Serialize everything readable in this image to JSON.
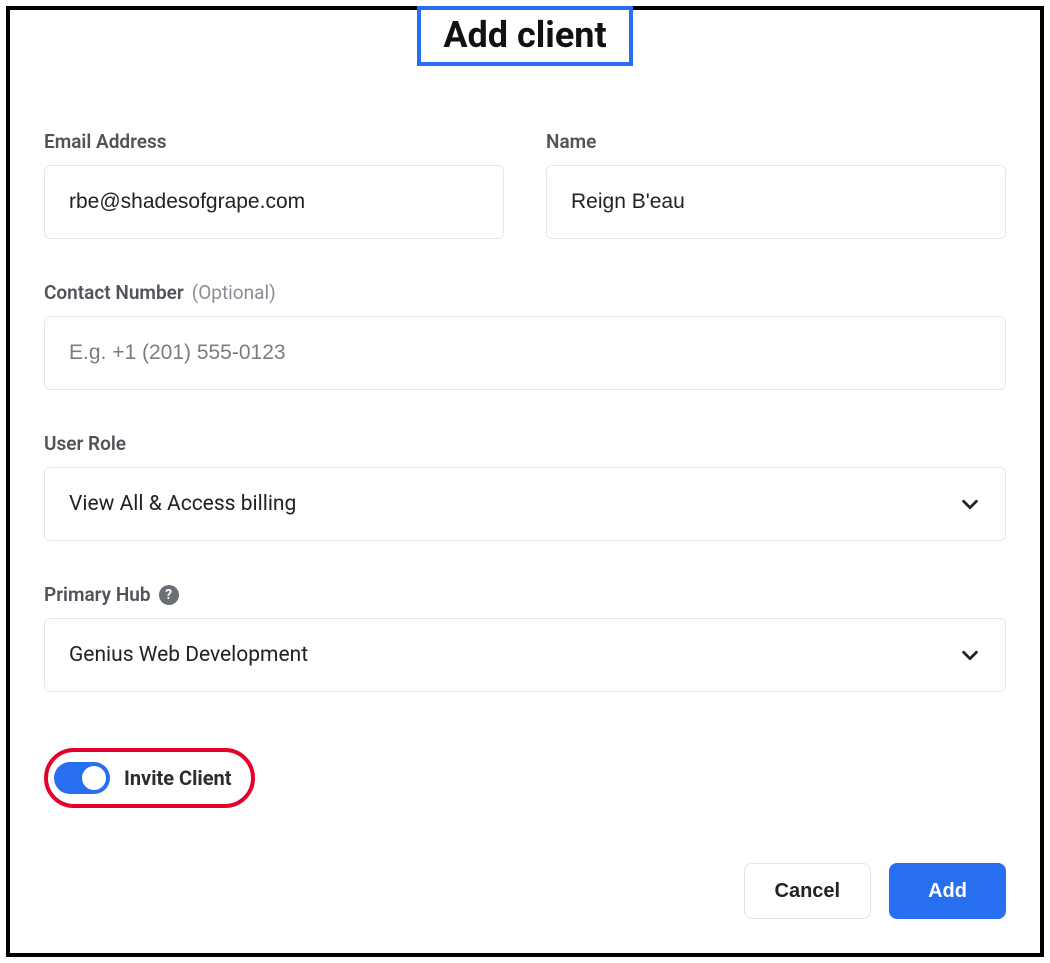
{
  "title": "Add client",
  "fields": {
    "email": {
      "label": "Email Address",
      "value": "rbe@shadesofgrape.com"
    },
    "name": {
      "label": "Name",
      "value": "Reign B'eau"
    },
    "contact": {
      "label": "Contact Number",
      "optional": "(Optional)",
      "value": "",
      "placeholder": "E.g. +1 (201) 555-0123"
    },
    "role": {
      "label": "User Role",
      "value": "View All & Access billing"
    },
    "hub": {
      "label": "Primary Hub",
      "value": "Genius Web Development"
    }
  },
  "toggle": {
    "label": "Invite Client",
    "on": true
  },
  "actions": {
    "cancel": "Cancel",
    "add": "Add"
  },
  "icons": {
    "help": "?"
  }
}
